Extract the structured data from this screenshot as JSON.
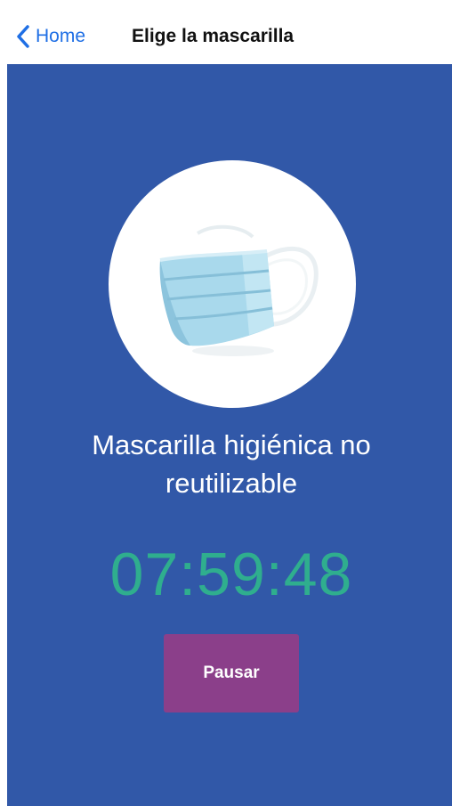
{
  "navbar": {
    "back_label": "Home",
    "back_icon": "chevron-left-icon",
    "title": "Elige la mascarilla"
  },
  "mask": {
    "image": "surgical-mask-image",
    "name": "Mascarilla higiénica no reutilizable"
  },
  "timer": {
    "value": "07:59:48"
  },
  "actions": {
    "pause_label": "Pausar"
  },
  "colors": {
    "background": "#3158a8",
    "navbar": "#ffffff",
    "link": "#1f6fe5",
    "timer": "#2fae8e",
    "pause_button": "#8b3f8a"
  }
}
